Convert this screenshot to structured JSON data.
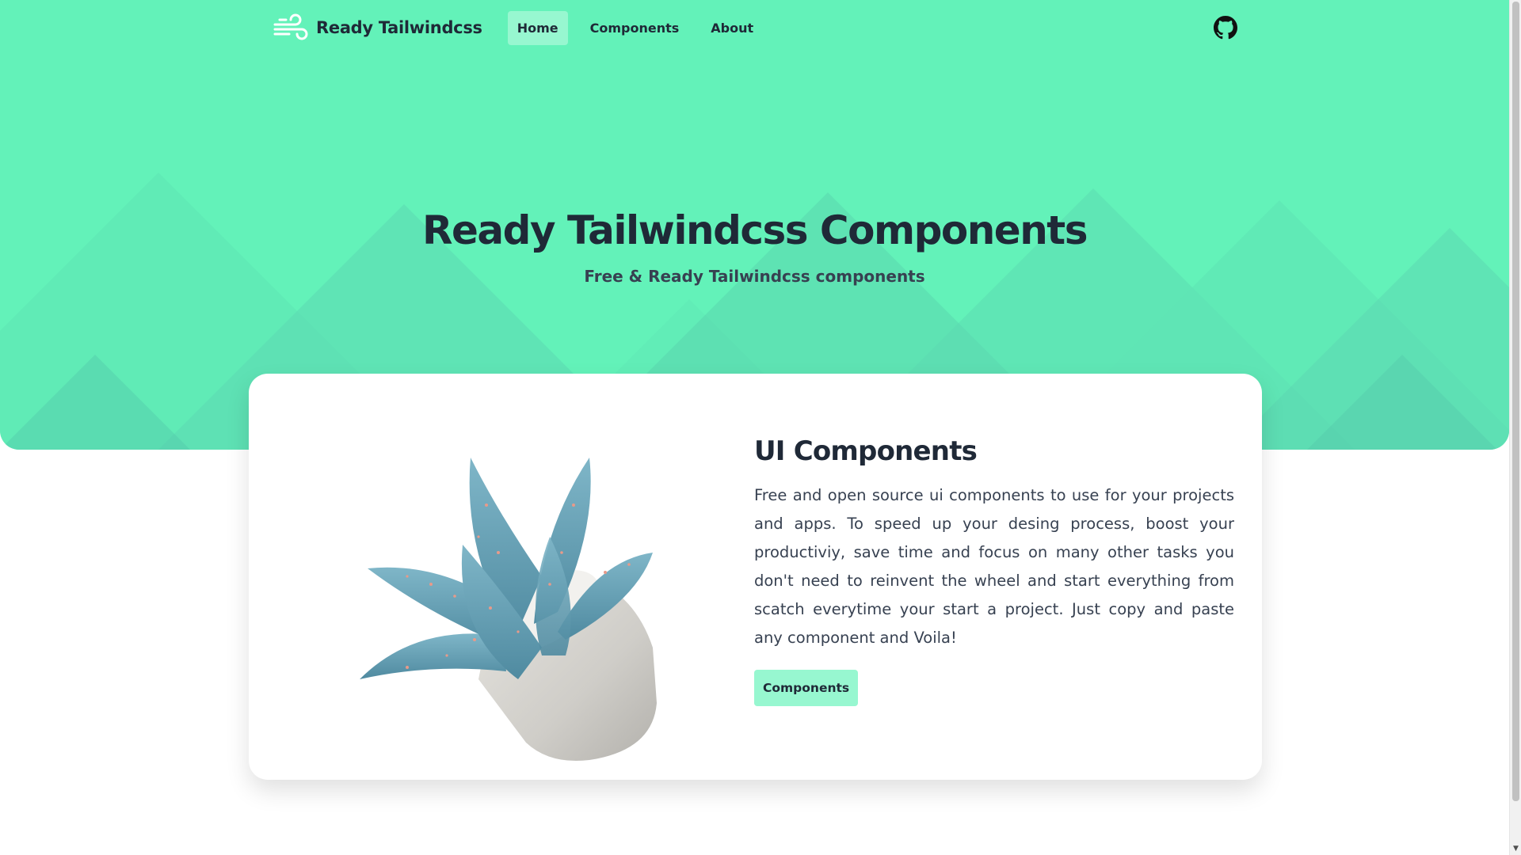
{
  "header": {
    "brand_name": "Ready Tailwindcss",
    "nav": [
      {
        "label": "Home",
        "active": true
      },
      {
        "label": "Components",
        "active": false
      },
      {
        "label": "About",
        "active": false
      }
    ],
    "github_icon": "github-icon"
  },
  "hero": {
    "title": "Ready Tailwindcss Components",
    "subtitle": "Free & Ready Tailwindcss components"
  },
  "card": {
    "title": "UI Components",
    "text": "Free and open source ui components to use for your projects and apps. To speed up your desing process, boost your productiviy, save time and focus on many other tasks you don't need to reinvent the wheel and start everything from scatch everytime your start a project. Just copy and paste any component and Voila!",
    "button_label": "Components",
    "image": "potted-plant-illustration"
  },
  "colors": {
    "accent": "#63f2b9",
    "accent_light": "#97f7d0",
    "text_dark": "#1f2937"
  }
}
